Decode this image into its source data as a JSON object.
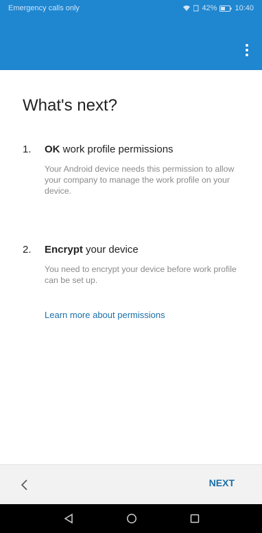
{
  "status_bar": {
    "carrier_text": "Emergency calls only",
    "battery_percent": "42%",
    "time": "10:40",
    "icons": [
      "wifi-icon",
      "signal-icon",
      "battery-icon"
    ]
  },
  "app_bar": {
    "color": "#1f86d0",
    "menu_icon": "overflow-menu-icon"
  },
  "main": {
    "title": "What's next?",
    "steps": [
      {
        "number": "1.",
        "heading_bold": "OK",
        "heading_rest": " work profile permissions",
        "description": "Your Android device needs this permission to allow your company to manage the work profile on your device."
      },
      {
        "number": "2.",
        "heading_bold": "Encrypt",
        "heading_rest": " your device",
        "description": "You need to encrypt your device before work profile can be set up."
      }
    ],
    "learn_more_label": "Learn more about permissions"
  },
  "bottom_bar": {
    "back_icon": "chevron-left-icon",
    "next_label": "NEXT"
  },
  "nav_bar": {
    "icons": [
      "nav-back-icon",
      "nav-home-icon",
      "nav-recents-icon"
    ]
  },
  "colors": {
    "accent": "#1f86d0",
    "link": "#1b6fa8"
  }
}
